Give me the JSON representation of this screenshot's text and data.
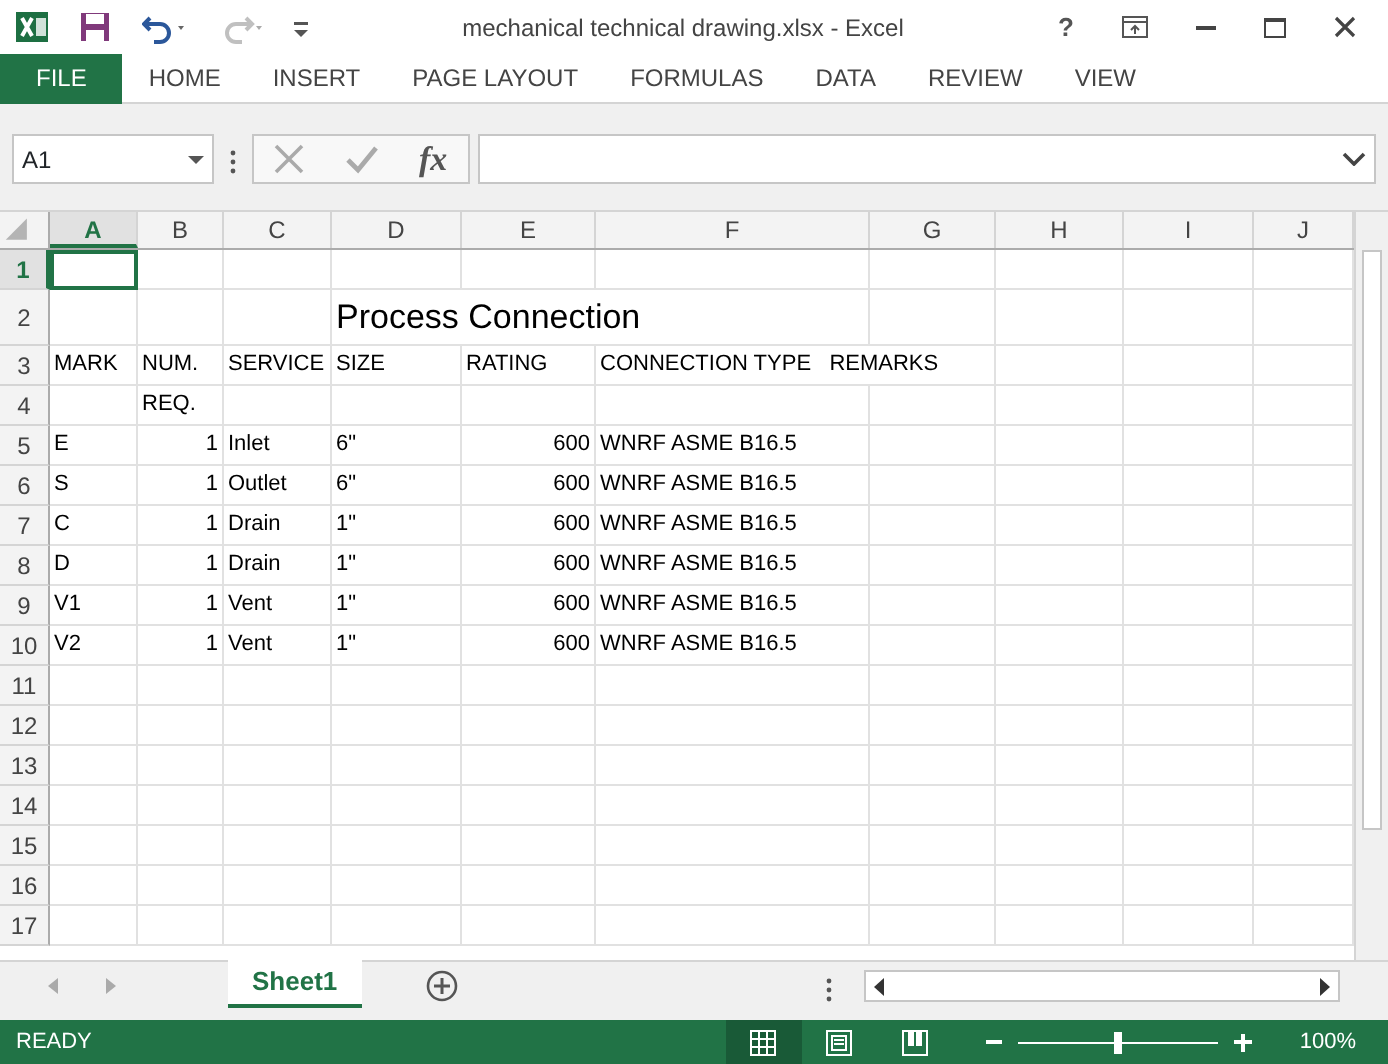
{
  "window": {
    "title": "mechanical technical drawing.xlsx - Excel",
    "help": "?"
  },
  "quick_access": {
    "redo_disabled": true
  },
  "ribbon_tabs": [
    {
      "label": "FILE",
      "selected": true
    },
    {
      "label": "HOME",
      "selected": false
    },
    {
      "label": "INSERT",
      "selected": false
    },
    {
      "label": "PAGE LAYOUT",
      "selected": false
    },
    {
      "label": "FORMULAS",
      "selected": false
    },
    {
      "label": "DATA",
      "selected": false
    },
    {
      "label": "REVIEW",
      "selected": false
    },
    {
      "label": "VIEW",
      "selected": false
    }
  ],
  "formula_bar": {
    "name_box": "A1",
    "fx": "fx"
  },
  "columns": [
    {
      "label": "A",
      "selected": true
    },
    {
      "label": "B",
      "selected": false
    },
    {
      "label": "C",
      "selected": false
    },
    {
      "label": "D",
      "selected": false
    },
    {
      "label": "E",
      "selected": false
    },
    {
      "label": "F",
      "selected": false
    },
    {
      "label": "G",
      "selected": false
    },
    {
      "label": "H",
      "selected": false
    },
    {
      "label": "I",
      "selected": false
    },
    {
      "label": "J",
      "selected": false
    }
  ],
  "rows": [
    {
      "number": "1",
      "selected": true,
      "cells": {}
    },
    {
      "number": "2",
      "selected": false,
      "cells": {
        "D": {
          "text": "Process Connection",
          "kind": "title"
        }
      }
    },
    {
      "number": "3",
      "selected": false,
      "cells": {
        "A": {
          "text": "MARK",
          "kind": "text"
        },
        "B": {
          "text": "NUM.",
          "kind": "text"
        },
        "C": {
          "text": "SERVICE",
          "kind": "text"
        },
        "D": {
          "text": "SIZE",
          "kind": "text"
        },
        "E": {
          "text": "RATING",
          "kind": "text"
        },
        "F": {
          "text": "CONNECTION TYPE   REMARKS",
          "kind": "text"
        }
      }
    },
    {
      "number": "4",
      "selected": false,
      "cells": {
        "B": {
          "text": "REQ.",
          "kind": "text"
        }
      }
    },
    {
      "number": "5",
      "selected": false,
      "cells": {
        "A": {
          "text": "E",
          "kind": "text"
        },
        "B": {
          "text": "1",
          "kind": "number"
        },
        "C": {
          "text": "Inlet",
          "kind": "text"
        },
        "D": {
          "text": "6\"",
          "kind": "text"
        },
        "E": {
          "text": "600",
          "kind": "number"
        },
        "F": {
          "text": "WNRF ASME B16.5",
          "kind": "text"
        }
      }
    },
    {
      "number": "6",
      "selected": false,
      "cells": {
        "A": {
          "text": "S",
          "kind": "text"
        },
        "B": {
          "text": "1",
          "kind": "number"
        },
        "C": {
          "text": "Outlet",
          "kind": "text"
        },
        "D": {
          "text": "6\"",
          "kind": "text"
        },
        "E": {
          "text": "600",
          "kind": "number"
        },
        "F": {
          "text": "WNRF ASME B16.5",
          "kind": "text"
        }
      }
    },
    {
      "number": "7",
      "selected": false,
      "cells": {
        "A": {
          "text": "C",
          "kind": "text"
        },
        "B": {
          "text": "1",
          "kind": "number"
        },
        "C": {
          "text": "Drain",
          "kind": "text"
        },
        "D": {
          "text": "1\"",
          "kind": "text"
        },
        "E": {
          "text": "600",
          "kind": "number"
        },
        "F": {
          "text": "WNRF ASME B16.5",
          "kind": "text"
        }
      }
    },
    {
      "number": "8",
      "selected": false,
      "cells": {
        "A": {
          "text": "D",
          "kind": "text"
        },
        "B": {
          "text": "1",
          "kind": "number"
        },
        "C": {
          "text": "Drain",
          "kind": "text"
        },
        "D": {
          "text": "1\"",
          "kind": "text"
        },
        "E": {
          "text": "600",
          "kind": "number"
        },
        "F": {
          "text": "WNRF ASME B16.5",
          "kind": "text"
        }
      }
    },
    {
      "number": "9",
      "selected": false,
      "cells": {
        "A": {
          "text": "V1",
          "kind": "text"
        },
        "B": {
          "text": "1",
          "kind": "number"
        },
        "C": {
          "text": "Vent",
          "kind": "text"
        },
        "D": {
          "text": "1\"",
          "kind": "text"
        },
        "E": {
          "text": "600",
          "kind": "number"
        },
        "F": {
          "text": "WNRF ASME B16.5",
          "kind": "text"
        }
      }
    },
    {
      "number": "10",
      "selected": false,
      "cells": {
        "A": {
          "text": "V2",
          "kind": "text"
        },
        "B": {
          "text": "1",
          "kind": "number"
        },
        "C": {
          "text": "Vent",
          "kind": "text"
        },
        "D": {
          "text": "1\"",
          "kind": "text"
        },
        "E": {
          "text": "600",
          "kind": "number"
        },
        "F": {
          "text": "WNRF ASME B16.5",
          "kind": "text"
        }
      }
    },
    {
      "number": "11",
      "selected": false,
      "cells": {}
    },
    {
      "number": "12",
      "selected": false,
      "cells": {}
    },
    {
      "number": "13",
      "selected": false,
      "cells": {}
    },
    {
      "number": "14",
      "selected": false,
      "cells": {}
    },
    {
      "number": "15",
      "selected": false,
      "cells": {}
    },
    {
      "number": "16",
      "selected": false,
      "cells": {}
    },
    {
      "number": "17",
      "selected": false,
      "cells": {}
    }
  ],
  "sheet_tabs": [
    {
      "label": "Sheet1",
      "selected": true
    }
  ],
  "status_bar": {
    "status": "READY",
    "views": [
      {
        "kind": "normal",
        "selected": true
      },
      {
        "kind": "page_layout",
        "selected": false
      },
      {
        "kind": "page_break",
        "selected": false
      }
    ],
    "zoom": {
      "level": 0.5,
      "reading": "100%"
    }
  }
}
